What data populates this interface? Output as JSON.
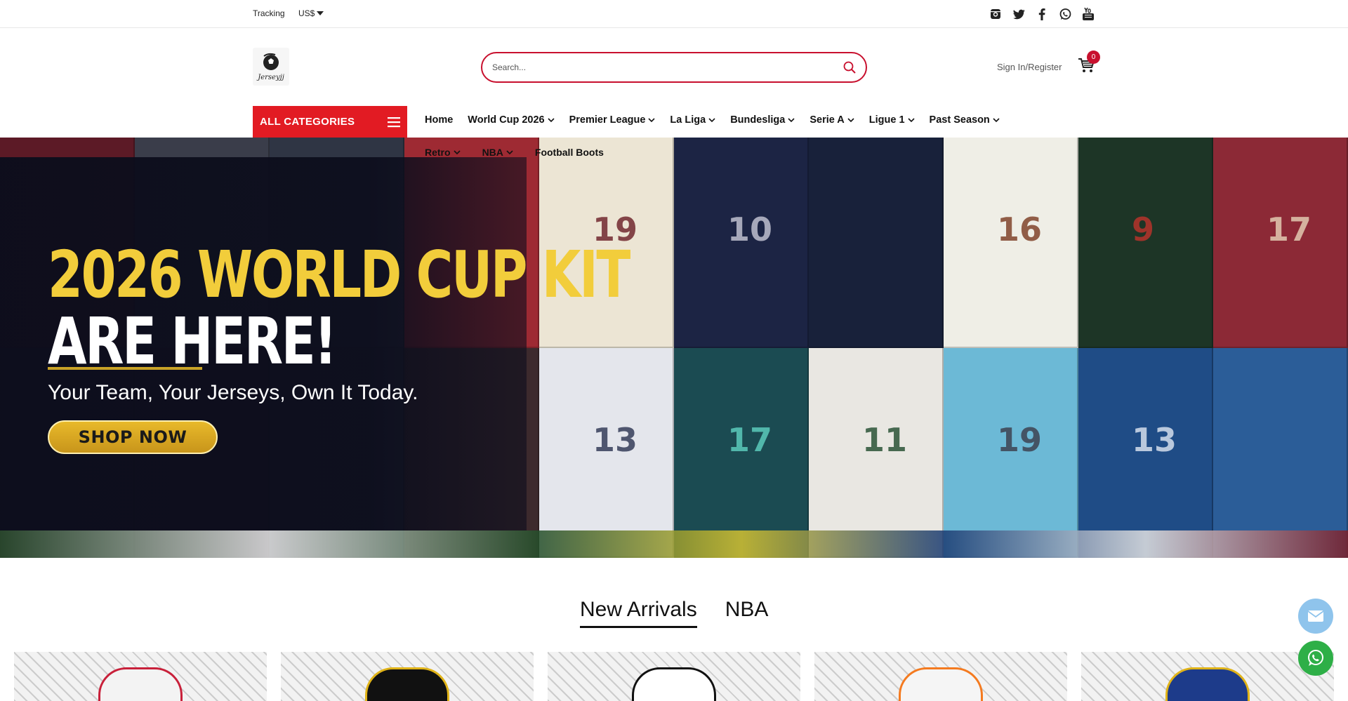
{
  "topbar": {
    "tracking": "Tracking",
    "currency": "US$",
    "social_icons": [
      "instagram-icon",
      "twitter-icon",
      "facebook-icon",
      "whatsapp-icon",
      "youtube-icon"
    ]
  },
  "header": {
    "logo_text": "Jerseyjj",
    "search_placeholder": "Search...",
    "signin": "Sign In/Register",
    "cart_count": "0"
  },
  "nav": {
    "all_categories": "ALL CATEGORIES",
    "items": [
      "Home",
      "World Cup 2026",
      "Premier League",
      "La Liga",
      "Bundesliga",
      "Serie A",
      "Ligue 1",
      "Past Season"
    ],
    "items_row2": [
      "Retro",
      "NBA",
      "Football Boots"
    ]
  },
  "hero": {
    "line1": "2026 WORLD CUP KIT",
    "line2": "ARE HERE!",
    "tagline": "Your Team, Your Jerseys, Own It Today.",
    "cta": "SHOP NOW"
  },
  "tabs": [
    "New Arrivals",
    "NBA"
  ],
  "colors": {
    "accent": "#e21b23",
    "hero_yellow": "#f2cd3b",
    "button_gold": "#d8a622"
  }
}
